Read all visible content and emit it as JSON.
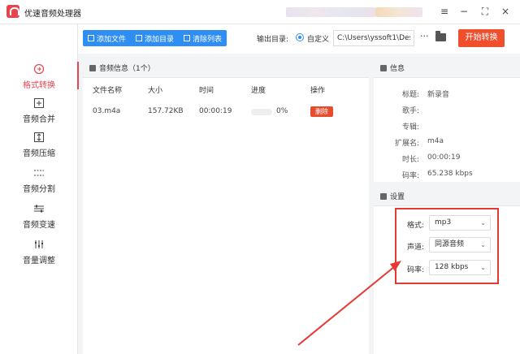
{
  "app": {
    "title": "优速音频处理器"
  },
  "sidebar": {
    "items": [
      {
        "label": "格式转换",
        "icon": "format-convert-icon",
        "active": true
      },
      {
        "label": "音频合并",
        "icon": "merge-icon"
      },
      {
        "label": "音频压缩",
        "icon": "compress-icon"
      },
      {
        "label": "音频分割",
        "icon": "split-icon"
      },
      {
        "label": "音频变速",
        "icon": "speed-icon"
      },
      {
        "label": "音量调整",
        "icon": "volume-icon"
      }
    ]
  },
  "toolbar": {
    "add_file": "添加文件",
    "add_folder": "添加目录",
    "clear_list": "清除列表",
    "output_label": "输出目录:",
    "custom_label": "自定义",
    "path_value": "C:\\Users\\yssoft1\\Deskt",
    "more": "···",
    "start": "开始转换"
  },
  "file_panel": {
    "title": "音频信息（1个）",
    "columns": [
      "文件名称",
      "大小",
      "时间",
      "进度",
      "操作"
    ],
    "rows": [
      {
        "name": "03.m4a",
        "size": "157.72KB",
        "time": "00:00:19",
        "progress": "0%",
        "action": "删除"
      }
    ]
  },
  "info": {
    "title": "信息",
    "fields": [
      {
        "label": "标题:",
        "value": "新录音"
      },
      {
        "label": "歌手:",
        "value": ""
      },
      {
        "label": "专辑:",
        "value": ""
      },
      {
        "label": "扩展名:",
        "value": "m4a"
      },
      {
        "label": "时长:",
        "value": "00:00:19"
      },
      {
        "label": "码率:",
        "value": "65.238 kbps"
      }
    ]
  },
  "settings": {
    "title": "设置",
    "format_label": "格式:",
    "format_value": "mp3",
    "channel_label": "声道:",
    "channel_value": "同源音频",
    "bitrate_label": "码率:",
    "bitrate_value": "128 kbps"
  },
  "colors": {
    "accent": "#e8464f",
    "primary": "#2f8ef3",
    "start": "#f04f2e",
    "annotation": "#e53935"
  }
}
